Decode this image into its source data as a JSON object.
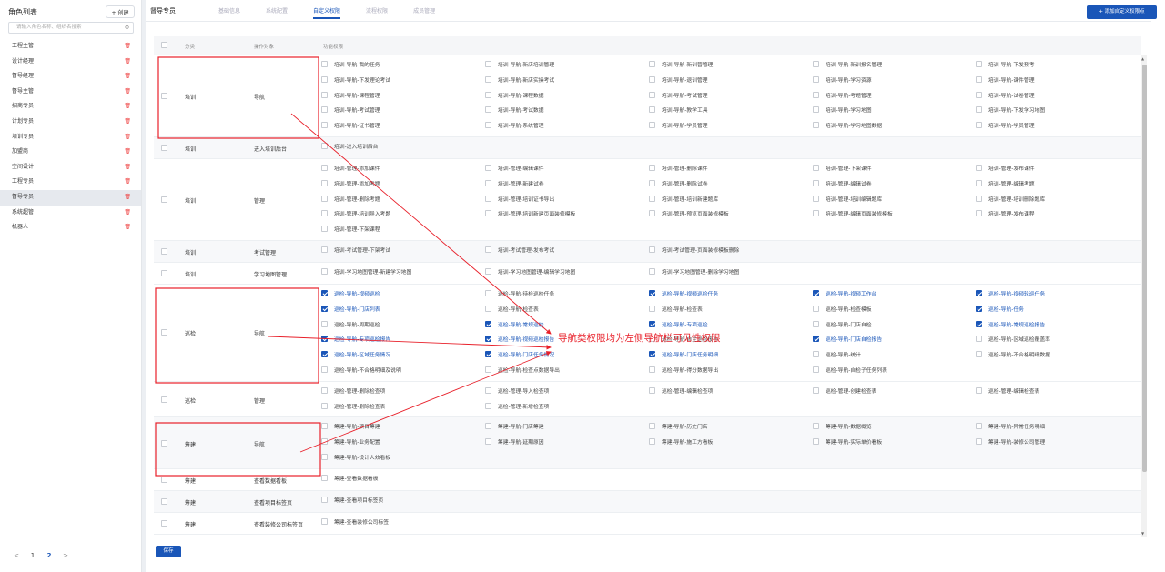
{
  "sidebar": {
    "title": "角色列表",
    "create_label": "+ 创建",
    "search_placeholder": "请输入角色名称、组织名搜索",
    "roles": [
      "工程主管",
      "设计经理",
      "督导经理",
      "督导主管",
      "招商专员",
      "计划专员",
      "培训专员",
      "加盟商",
      "空间设计",
      "工程专员",
      "督导专员",
      "系统超管",
      "机器人"
    ],
    "active_index": 10,
    "pager": {
      "prev": "<",
      "pages": [
        "1",
        "2"
      ],
      "current": "2",
      "next": ">"
    }
  },
  "header": {
    "title": "督导专员",
    "tabs": [
      "基础信息",
      "系统配置",
      "自定义权限",
      "流程权限",
      "成员管理"
    ],
    "active_tab": 2,
    "add_button": "+ 添加自定义权限点"
  },
  "table": {
    "headers": {
      "category": "分类",
      "target": "操作对象",
      "perms": "功能权限"
    },
    "rows": [
      {
        "category": "培训",
        "target": "导航",
        "alt": false,
        "perms": [
          [
            "培训-导航-我的任务",
            "培训-导航-新店培训管理",
            "培训-导航-新训营管理",
            "培训-导航-新训报名管理",
            "培训-导航-下发预考"
          ],
          [
            "培训-导航-下发理论考试",
            "培训-导航-新店实操考试",
            "培训-导航-退训管理",
            "培训-导航-学习资源",
            "培训-导航-课件管理"
          ],
          [
            "培训-导航-课程管理",
            "培训-导航-课程数据",
            "培训-导航-考试管理",
            "培训-导航-考题管理",
            "培训-导航-试卷管理"
          ],
          [
            "培训-导航-考试管理",
            "培训-导航-考试数据",
            "培训-导航-教学工具",
            "培训-导航-学习地图",
            "培训-导航-下发学习地图"
          ],
          [
            "培训-导航-证书管理",
            "培训-导航-系统管理",
            "培训-导航-学员管理",
            "培训-导航-学习地图数据",
            "培训-导航-学员管理"
          ]
        ]
      },
      {
        "category": "培训",
        "target": "进入培训后台",
        "alt": true,
        "perms": [
          [
            "培训-进入培训后台"
          ]
        ]
      },
      {
        "category": "培训",
        "target": "管理",
        "alt": false,
        "perms": [
          [
            "培训-管理-添加课件",
            "培训-管理-编辑课件",
            "培训-管理-删除课件",
            "培训-管理-下架课件",
            "培训-管理-发布课件"
          ],
          [
            "培训-管理-添加考题",
            "培训-管理-新建试卷",
            "培训-管理-删除试卷",
            "培训-管理-编辑试卷",
            "培训-管理-编辑考题"
          ],
          [
            "培训-管理-删除考题",
            "培训-管理-培训证书导出",
            "培训-管理-培训新建题库",
            "培训-管理-培训编辑题库",
            "培训-管理-培训删除题库"
          ],
          [
            "培训-管理-培训导入考题",
            "培训-管理-培训新建页面装修模板",
            "培训-管理-预览页面装修模板",
            "培训-管理-编辑页面装修模板",
            "培训-管理-发布课程"
          ],
          [
            "培训-管理-下架课程"
          ]
        ]
      },
      {
        "category": "培训",
        "target": "考试管理",
        "alt": true,
        "perms": [
          [
            "培训-考试管理-下架考试",
            "培训-考试管理-发布考试",
            "培训-考试管理-页面装修模板删除"
          ]
        ]
      },
      {
        "category": "培训",
        "target": "学习地图管理",
        "alt": false,
        "perms": [
          [
            "培训-学习地图管理-新建学习地图",
            "培训-学习地图管理-编辑学习地图",
            "培训-学习地图管理-删除学习地图"
          ]
        ]
      },
      {
        "category": "巡检",
        "target": "导航",
        "alt": false,
        "perms": [
          [
            "巡检-导航-视频巡检",
            "巡检-导航-待检巡检任务",
            "巡检-导航-视频巡检任务",
            "巡检-导航-视频工作台",
            "巡检-导航-视频轮巡任务"
          ],
          [
            "巡检-导航-门店列表",
            "巡检-导航-检查表",
            "巡检-导航-检查表",
            "巡检-导航-检查模板",
            "巡检-导航-任务"
          ],
          [
            "巡检-导航-周期巡检",
            "巡检-导航-常规巡检",
            "巡检-导航-专项巡检",
            "巡检-导航-门店自检",
            "巡检-导航-常规巡检报告"
          ],
          [
            "巡检-导航-专项巡检报告",
            "巡检-导航-视频巡检报告",
            "巡检-导航-自主巡检报告",
            "巡检-导航-门店自检报告",
            "巡检-导航-区域巡检覆盖率"
          ],
          [
            "巡检-导航-区域任务情况",
            "巡检-导航-门店任务情况",
            "巡检-导航-门店任务明细",
            "巡检-导航-统计",
            "巡检-导航-不合格明细数据"
          ],
          [
            "巡检-导航-不合格明细及说明",
            "巡检-导航-检查点数据导出",
            "巡检-导航-得分数据导出",
            "巡检-导航-自检子任务列表"
          ]
        ],
        "checked": [
          [
            1,
            0,
            1,
            1,
            1
          ],
          [
            1,
            0,
            0,
            0,
            1
          ],
          [
            0,
            1,
            1,
            0,
            1
          ],
          [
            1,
            1,
            0,
            1,
            0
          ],
          [
            1,
            1,
            1,
            0,
            0
          ],
          [
            0,
            0,
            0,
            0
          ]
        ]
      },
      {
        "category": "巡检",
        "target": "管理",
        "alt": false,
        "perms": [
          [
            "巡检-管理-删除检查项",
            "巡检-管理-导入检查项",
            "巡检-管理-编辑检查项",
            "巡检-管理-创建检查表",
            "巡检-管理-编辑检查表"
          ],
          [
            "巡检-管理-删除检查表",
            "巡检-管理-新增检查项"
          ]
        ]
      },
      {
        "category": "筹建",
        "target": "导航",
        "alt": true,
        "perms": [
          [
            "筹建-导航-项目筹建",
            "筹建-导航-门店筹建",
            "筹建-导航-历史门店",
            "筹建-导航-数据概览",
            "筹建-导航-异常任务明细"
          ],
          [
            "筹建-导航-业务配置",
            "筹建-导航-延期原因",
            "筹建-导航-施工方看板",
            "筹建-导航-实际单价看板",
            "筹建-导航-装修公司管理"
          ],
          [
            "筹建-导航-设计人效看板"
          ]
        ]
      },
      {
        "category": "筹建",
        "target": "查看数据看板",
        "alt": false,
        "perms": [
          [
            "筹建-查看数据看板"
          ]
        ]
      },
      {
        "category": "筹建",
        "target": "查看项目标签页",
        "alt": true,
        "perms": [
          [
            "筹建-查看项目标签页"
          ]
        ]
      },
      {
        "category": "筹建",
        "target": "查看装修公司标签页",
        "alt": false,
        "perms": [
          [
            "筹建-查看装修公司标签"
          ]
        ]
      }
    ]
  },
  "save_label": "保存",
  "annotation": {
    "text": "导航类权限均为左侧导航栏可见性权限",
    "color": "#e8202a"
  }
}
